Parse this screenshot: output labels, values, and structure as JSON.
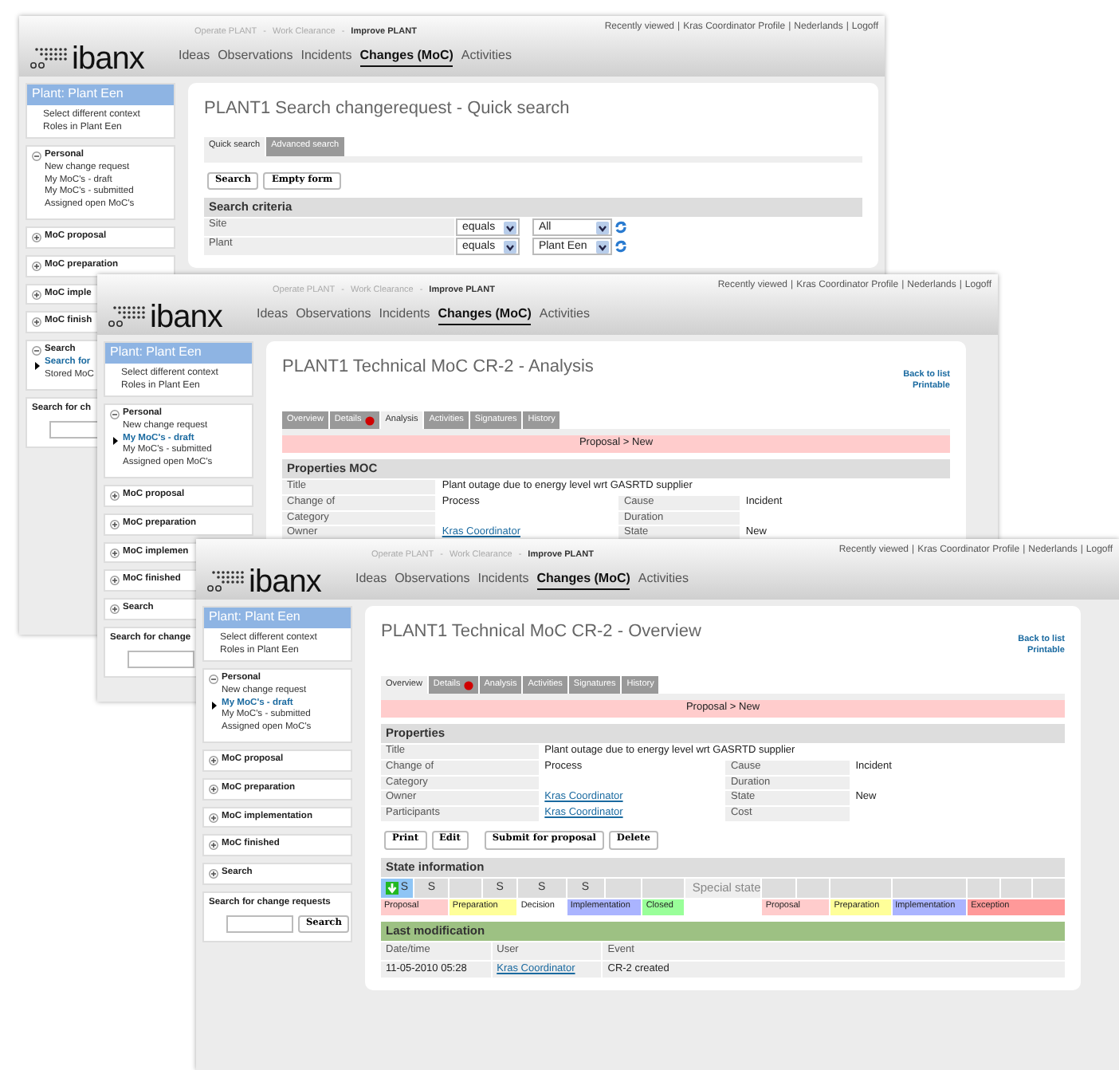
{
  "windows": [
    {
      "header": {
        "logo": "ibanx",
        "breadcrumb_separator": "-",
        "breadcrumb": [
          {
            "label": "Operate PLANT",
            "current": false
          },
          {
            "label": "Work Clearance",
            "current": false
          },
          {
            "label": "Improve PLANT",
            "current": true
          }
        ],
        "nav": [
          {
            "label": "Ideas",
            "selected": false
          },
          {
            "label": "Observations",
            "selected": false
          },
          {
            "label": "Incidents",
            "selected": false
          },
          {
            "label": "Changes (MoC)",
            "selected": true
          },
          {
            "label": "Activities",
            "selected": false
          }
        ],
        "link_separator": "|",
        "top_links": [
          "Recently viewed",
          "Kras Coordinator Profile",
          "Nederlands",
          "Logoff"
        ]
      },
      "sidebar": {
        "context": {
          "title": "Plant: Plant Een",
          "links": [
            "Select different context",
            "Roles in Plant Een"
          ]
        },
        "groups": [
          {
            "title": "Personal",
            "expanded": true,
            "items": [
              {
                "label": "New change request",
                "selected": false
              },
              {
                "label": "My MoC's - draft",
                "selected": false
              },
              {
                "label": "My MoC's - submitted",
                "selected": false
              },
              {
                "label": "Assigned open MoC's",
                "selected": false
              }
            ]
          },
          {
            "title": "MoC proposal",
            "expanded": false
          },
          {
            "title": "MoC preparation",
            "expanded": false
          },
          {
            "title": "MoC imple",
            "expanded": false
          },
          {
            "title": "MoC finish",
            "expanded": false
          },
          {
            "title": "Search",
            "expanded": true,
            "items": [
              {
                "label": "Search for",
                "selected": true
              },
              {
                "label": "Stored MoC",
                "selected": false
              }
            ]
          }
        ],
        "search": {
          "title": "Search for ch"
        }
      },
      "main": {
        "title": "PLANT1 Search changerequest - Quick search",
        "sections": [
          {
            "kind": "tabs",
            "tabs": [
              {
                "label": "Quick search",
                "selected": true,
                "alert": false
              },
              {
                "label": "Advanced search",
                "selected": false,
                "alert": false
              }
            ]
          },
          {
            "kind": "buttons",
            "groups": [
              [
                "Search",
                "Empty form"
              ]
            ]
          },
          {
            "kind": "heading",
            "label": "Search criteria",
            "color": "#dddddd"
          },
          {
            "kind": "criteria",
            "rows": [
              {
                "label": "Site",
                "operator": "equals",
                "value": "All"
              },
              {
                "label": "Plant",
                "operator": "equals",
                "value": "Plant Een"
              }
            ]
          }
        ]
      }
    },
    {
      "header": {
        "logo": "ibanx",
        "breadcrumb_separator": "-",
        "breadcrumb": [
          {
            "label": "Operate PLANT",
            "current": false
          },
          {
            "label": "Work Clearance",
            "current": false
          },
          {
            "label": "Improve PLANT",
            "current": true
          }
        ],
        "nav": [
          {
            "label": "Ideas",
            "selected": false
          },
          {
            "label": "Observations",
            "selected": false
          },
          {
            "label": "Incidents",
            "selected": false
          },
          {
            "label": "Changes (MoC)",
            "selected": true
          },
          {
            "label": "Activities",
            "selected": false
          }
        ],
        "link_separator": "|",
        "top_links": [
          "Recently viewed",
          "Kras Coordinator Profile",
          "Nederlands",
          "Logoff"
        ]
      },
      "sidebar": {
        "context": {
          "title": "Plant: Plant Een",
          "links": [
            "Select different context",
            "Roles in Plant Een"
          ]
        },
        "groups": [
          {
            "title": "Personal",
            "expanded": true,
            "items": [
              {
                "label": "New change request",
                "selected": false
              },
              {
                "label": "My MoC's - draft",
                "selected": true
              },
              {
                "label": "My MoC's - submitted",
                "selected": false
              },
              {
                "label": "Assigned open MoC's",
                "selected": false
              }
            ]
          },
          {
            "title": "MoC proposal",
            "expanded": false
          },
          {
            "title": "MoC preparation",
            "expanded": false
          },
          {
            "title": "MoC implemen",
            "expanded": false
          },
          {
            "title": "MoC finished",
            "expanded": false
          },
          {
            "title": "Search",
            "expanded": false
          }
        ],
        "search": {
          "title": "Search for change"
        }
      },
      "main": {
        "title": "PLANT1 Technical MoC CR-2 - Analysis",
        "side_links": [
          "Back to list",
          "Printable"
        ],
        "sections": [
          {
            "kind": "tabs",
            "tabs": [
              {
                "label": "Overview",
                "selected": false,
                "alert": false
              },
              {
                "label": "Details",
                "selected": false,
                "alert": true
              },
              {
                "label": "Analysis",
                "selected": true,
                "alert": false
              },
              {
                "label": "Activities",
                "selected": false,
                "alert": false
              },
              {
                "label": "Signatures",
                "selected": false,
                "alert": false
              },
              {
                "label": "History",
                "selected": false,
                "alert": false
              }
            ]
          },
          {
            "kind": "status",
            "label": "Proposal > New"
          },
          {
            "kind": "heading",
            "label": "Properties MOC",
            "color": "#dddddd"
          },
          {
            "kind": "props",
            "rows": [
              [
                {
                  "label": "Title",
                  "value": "Plant outage due to energy level wrt GASRTD supplier",
                  "link": false
                }
              ],
              [
                {
                  "label": "Change of",
                  "value": "Process",
                  "link": false
                },
                {
                  "label": "Cause",
                  "value": "Incident",
                  "link": false
                }
              ],
              [
                {
                  "label": "Category"
                },
                {
                  "label": "Duration"
                }
              ],
              [
                {
                  "label": "Owner",
                  "value": "Kras Coordinator",
                  "link": true
                },
                {
                  "label": "State",
                  "value": "New",
                  "link": false
                }
              ]
            ]
          }
        ]
      }
    },
    {
      "header": {
        "logo": "ibanx",
        "breadcrumb_separator": "-",
        "breadcrumb": [
          {
            "label": "Operate PLANT",
            "current": false
          },
          {
            "label": "Work Clearance",
            "current": false
          },
          {
            "label": "Improve PLANT",
            "current": true
          }
        ],
        "nav": [
          {
            "label": "Ideas",
            "selected": false
          },
          {
            "label": "Observations",
            "selected": false
          },
          {
            "label": "Incidents",
            "selected": false
          },
          {
            "label": "Changes (MoC)",
            "selected": true
          },
          {
            "label": "Activities",
            "selected": false
          }
        ],
        "link_separator": "|",
        "top_links": [
          "Recently viewed",
          "Kras Coordinator Profile",
          "Nederlands",
          "Logoff"
        ]
      },
      "sidebar": {
        "context": {
          "title": "Plant: Plant Een",
          "links": [
            "Select different context",
            "Roles in Plant Een"
          ]
        },
        "groups": [
          {
            "title": "Personal",
            "expanded": true,
            "items": [
              {
                "label": "New change request",
                "selected": false
              },
              {
                "label": "My MoC's - draft",
                "selected": true
              },
              {
                "label": "My MoC's - submitted",
                "selected": false
              },
              {
                "label": "Assigned open MoC's",
                "selected": false
              }
            ]
          },
          {
            "title": "MoC proposal",
            "expanded": false
          },
          {
            "title": "MoC preparation",
            "expanded": false
          },
          {
            "title": "MoC implementation",
            "expanded": false
          },
          {
            "title": "MoC finished",
            "expanded": false
          },
          {
            "title": "Search",
            "expanded": false
          }
        ],
        "search": {
          "title": "Search for change requests",
          "button": "Search"
        }
      },
      "main": {
        "title": "PLANT1 Technical MoC CR-2 - Overview",
        "side_links": [
          "Back to list",
          "Printable"
        ],
        "sections": [
          {
            "kind": "tabs",
            "tabs": [
              {
                "label": "Overview",
                "selected": true,
                "alert": false
              },
              {
                "label": "Details",
                "selected": false,
                "alert": true
              },
              {
                "label": "Analysis",
                "selected": false,
                "alert": false
              },
              {
                "label": "Activities",
                "selected": false,
                "alert": false
              },
              {
                "label": "Signatures",
                "selected": false,
                "alert": false
              },
              {
                "label": "History",
                "selected": false,
                "alert": false
              }
            ]
          },
          {
            "kind": "status",
            "label": "Proposal > New"
          },
          {
            "kind": "heading",
            "label": "Properties",
            "color": "#dddddd"
          },
          {
            "kind": "props",
            "rows": [
              [
                {
                  "label": "Title",
                  "value": "Plant outage due to energy level wrt GASRTD supplier",
                  "link": false
                }
              ],
              [
                {
                  "label": "Change of",
                  "value": "Process",
                  "link": false
                },
                {
                  "label": "Cause",
                  "value": "Incident",
                  "link": false
                }
              ],
              [
                {
                  "label": "Category"
                },
                {
                  "label": "Duration"
                }
              ],
              [
                {
                  "label": "Owner",
                  "value": "Kras Coordinator",
                  "link": true
                },
                {
                  "label": "State",
                  "value": "New",
                  "link": false
                }
              ],
              [
                {
                  "label": "Participants",
                  "value": "Kras Coordinator",
                  "link": true
                },
                {
                  "label": "Cost"
                }
              ]
            ]
          },
          {
            "kind": "buttons",
            "groups": [
              [
                "Print",
                "Edit"
              ],
              [
                "Submit for proposal",
                "Delete"
              ]
            ]
          },
          {
            "kind": "heading",
            "label": "State information",
            "color": "#dddddd"
          },
          {
            "kind": "states",
            "stages": [
              {
                "label": "Proposal",
                "color": "#ffcccc",
                "steps": [
                  {
                    "current": true,
                    "text": "S"
                  },
                  {
                    "current": false,
                    "text": "S"
                  }
                ]
              },
              {
                "label": "Preparation",
                "color": "#ffff99",
                "steps": [
                  {
                    "current": false
                  },
                  {
                    "current": false,
                    "text": "S"
                  }
                ]
              },
              {
                "label": "Decision",
                "color": "#ffffff",
                "steps": [
                  {
                    "current": false,
                    "text": "S"
                  }
                ]
              },
              {
                "label": "Implementation",
                "color": "#aab4ff",
                "steps": [
                  {
                    "current": false,
                    "text": "S"
                  },
                  {
                    "current": false
                  }
                ]
              },
              {
                "label": "Closed",
                "color": "#99ff99",
                "steps": [
                  {
                    "current": false
                  }
                ]
              }
            ],
            "special_label": "Special state",
            "special_stages": [
              {
                "label": "Proposal",
                "color": "#ffcccc",
                "steps": [
                  {
                    "current": false
                  },
                  {
                    "current": false
                  }
                ]
              },
              {
                "label": "Preparation",
                "color": "#ffff99",
                "steps": [
                  {
                    "current": false
                  }
                ]
              },
              {
                "label": "Implementation",
                "color": "#aab4ff",
                "steps": [
                  {
                    "current": false
                  }
                ]
              },
              {
                "label": "Exception",
                "color": "#ff9999",
                "steps": [
                  {
                    "current": false
                  },
                  {
                    "current": false
                  },
                  {
                    "current": false
                  }
                ]
              }
            ]
          },
          {
            "kind": "heading",
            "label": "Last modification",
            "color": "#9dc183"
          },
          {
            "kind": "history",
            "columns": [
              "Date/time",
              "User",
              "Event"
            ],
            "rows": [
              [
                {
                  "text": "11-05-2010 05:28",
                  "link": false
                },
                {
                  "text": "Kras Coordinator",
                  "link": true
                },
                {
                  "text": "CR-2 created",
                  "link": false
                }
              ]
            ]
          }
        ]
      }
    }
  ]
}
